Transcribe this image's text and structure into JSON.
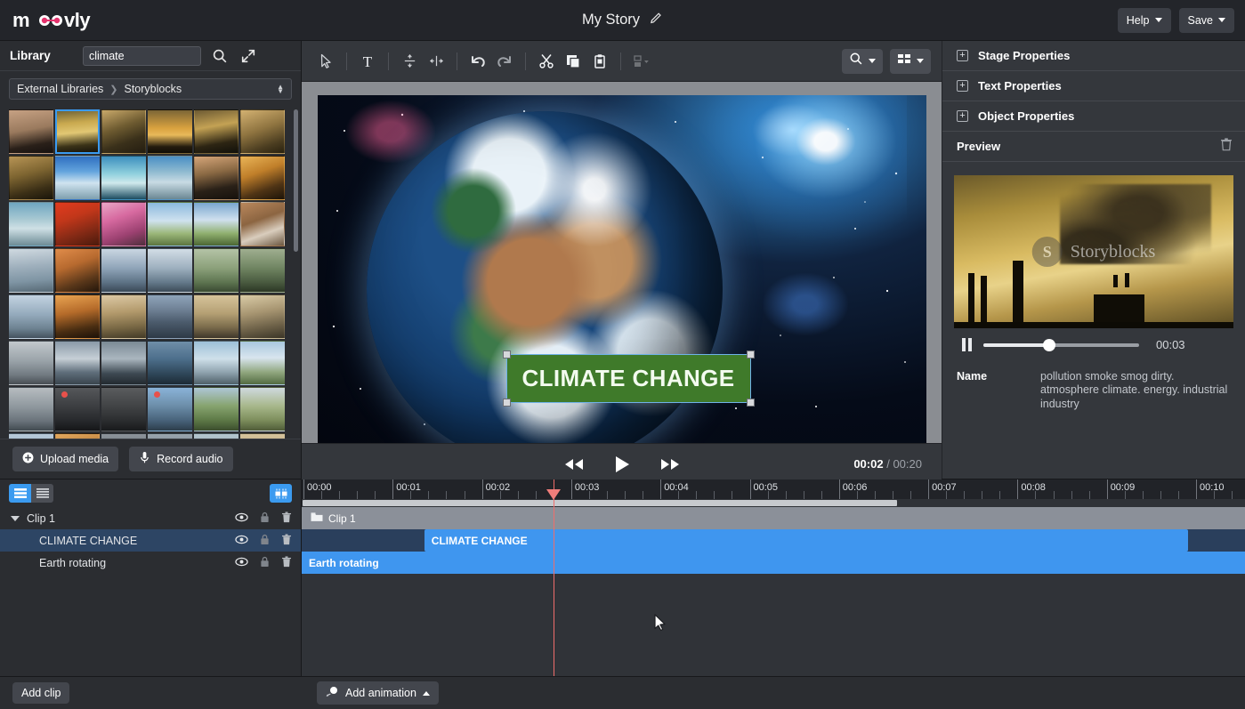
{
  "topbar": {
    "logo_text": "moovly",
    "story_title": "My Story",
    "edit_icon": "pencil-icon",
    "help_label": "Help",
    "save_label": "Save"
  },
  "library": {
    "title": "Library",
    "search_value": "climate",
    "search_placeholder": "",
    "search_icon": "search-icon",
    "expand_icon": "expand-icon",
    "breadcrumb_root": "External Libraries",
    "breadcrumb_current": "Storyblocks",
    "upload_label": "Upload media",
    "record_label": "Record audio",
    "selected_thumb_index": 1,
    "thumb_count": 48
  },
  "stage": {
    "toolbar": {
      "select_icon": "cursor-arrow-icon",
      "text_icon": "text-tool-icon",
      "align_vertical_icon": "align-vertical-icon",
      "align_horizontal_icon": "align-horizontal-icon",
      "undo_icon": "undo-icon",
      "redo_icon": "redo-icon",
      "cut_icon": "scissors-icon",
      "copy_icon": "copy-icon",
      "paste_icon": "paste-icon",
      "arrange_icon": "arrange-icon",
      "zoom_label_icon": "zoom-magnifier-icon",
      "grid_label_icon": "grid-layout-icon"
    },
    "text_object_label": "CLIMATE CHANGE",
    "player": {
      "rewind_icon": "rewind-icon",
      "play_icon": "play-icon",
      "forward_icon": "fast-forward-icon",
      "current_time": "00:02",
      "separator": "/",
      "total_time": "00:20"
    }
  },
  "rightpanel": {
    "sections": [
      {
        "label": "Stage Properties",
        "expander": "plus-icon"
      },
      {
        "label": "Text Properties",
        "expander": "plus-icon"
      },
      {
        "label": "Object Properties",
        "expander": "plus-icon"
      }
    ],
    "preview_label": "Preview",
    "delete_icon": "trash-icon",
    "watermark_text": "Storyblocks",
    "watermark_mark": "S",
    "pause_icon": "pause-icon",
    "preview_time": "00:03",
    "meta_key": "Name",
    "meta_value": "pollution smoke smog dirty. atmosphere climate. energy. industrial industry"
  },
  "timeline": {
    "view_list_icon": "list-view-icon",
    "view_compact_icon": "compact-view-icon",
    "split_view_icon": "split-view-icon",
    "ruler_labels": [
      "00:00",
      "00:01",
      "00:02",
      "00:03",
      "00:04",
      "00:05",
      "00:06",
      "00:07",
      "00:08",
      "00:09",
      "00:10"
    ],
    "layers": [
      {
        "name": "Clip 1",
        "type": "group",
        "selected": false,
        "expanded": true
      },
      {
        "name": "CLIMATE CHANGE",
        "type": "object",
        "selected": true
      },
      {
        "name": "Earth rotating",
        "type": "object",
        "selected": false
      }
    ],
    "layer_icons": {
      "eye": "eye-icon",
      "lock": "lock-icon",
      "trash": "trash-icon"
    },
    "clip_track_label": "Clip 1",
    "clip_track_icon": "folder-icon",
    "bars": [
      {
        "label": "CLIMATE CHANGE",
        "left_pct": 13.0,
        "width_pct": 81.0
      },
      {
        "label": "Earth rotating",
        "left_pct": 0.0,
        "width_pct": 100.0
      }
    ],
    "playhead_time": "00:02"
  },
  "bottombar": {
    "add_clip_label": "Add clip",
    "add_animation_label": "Add animation",
    "add_animation_icon": "animation-icon"
  }
}
